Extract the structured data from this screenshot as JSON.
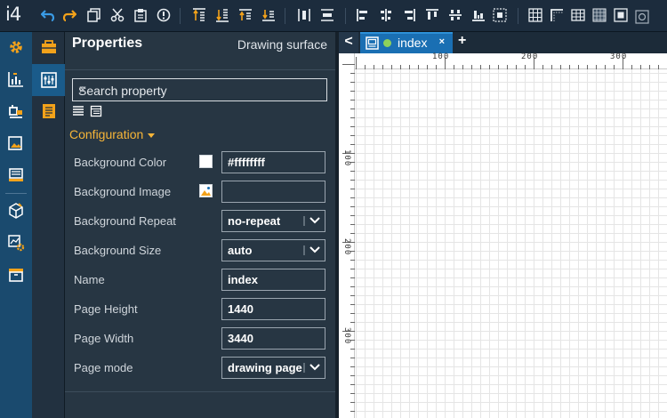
{
  "app": {
    "logo": "i4"
  },
  "toolbar": {
    "items": [
      "undo-icon",
      "redo-icon",
      "copy-icon",
      "cut-icon",
      "paste-icon",
      "error-icon",
      "move-up-icon",
      "move-down-icon",
      "bring-forward-icon",
      "send-backward-icon",
      "distribute-h-icon",
      "distribute-v-icon",
      "align-left-icon",
      "align-center-icon",
      "align-right-icon",
      "align-top-icon",
      "align-middle-icon",
      "align-bottom-icon",
      "center-icon",
      "grid-icon",
      "corner-icon",
      "table-icon",
      "pattern-icon",
      "fit-icon",
      "zoom-icon"
    ]
  },
  "leftrail": {
    "items": [
      "settings-icon",
      "chart-icon",
      "stamp-icon",
      "image-report-icon",
      "printer-icon",
      "package-icon",
      "gear-report-icon",
      "archive-icon"
    ]
  },
  "secondrail": {
    "items": [
      "toolbox-icon",
      "properties-icon",
      "document-icon"
    ]
  },
  "panel": {
    "title": "Properties",
    "subtitle": "Drawing surface",
    "search_placeholder": "Search property",
    "search_clear": "✕",
    "section": "Configuration",
    "properties": [
      {
        "label": "Background Color",
        "value": "#ffffffff",
        "kind": "color",
        "color": "#ffffff"
      },
      {
        "label": "Background Image",
        "value": "",
        "kind": "image"
      },
      {
        "label": "Background Repeat",
        "value": "no-repeat",
        "kind": "select"
      },
      {
        "label": "Background Size",
        "value": "auto",
        "kind": "select"
      },
      {
        "label": "Name",
        "value": "index",
        "kind": "text"
      },
      {
        "label": "Page Height",
        "value": "1440",
        "kind": "text"
      },
      {
        "label": "Page Width",
        "value": "3440",
        "kind": "text"
      },
      {
        "label": "Page mode",
        "value": "drawing page",
        "kind": "select"
      }
    ]
  },
  "tabs": {
    "back": "<",
    "active": {
      "label": "index",
      "close": "×",
      "status_color": "#8ed15b"
    },
    "add": "+"
  },
  "rulers": {
    "horizontal": [
      "100",
      "200",
      "300"
    ],
    "vertical": [
      "100",
      "200",
      "300"
    ]
  },
  "colors": {
    "accent": "#f6b538",
    "tab_active": "#1a6fb3",
    "rail": "#1a4a6e",
    "panel": "#273643"
  }
}
